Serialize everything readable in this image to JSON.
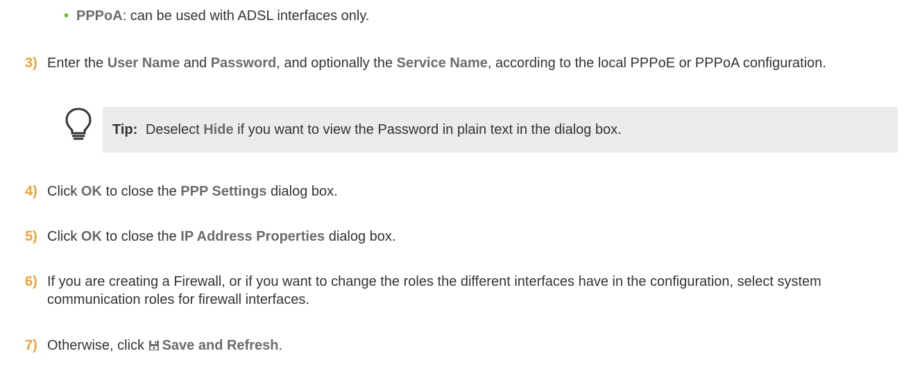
{
  "bullet": {
    "symbol": "•",
    "term": "PPPoA",
    "text": ": can be used with ADSL interfaces only."
  },
  "steps": [
    {
      "num": "3)",
      "parts": {
        "a": "Enter the ",
        "b": "User Name",
        "c": " and ",
        "d": "Password",
        "e": ", and optionally the ",
        "f": "Service Name",
        "g": ", according to the local PPPoE or PPPoA configuration."
      }
    },
    {
      "num": "4)",
      "parts": {
        "a": "Click ",
        "b": "OK",
        "c": " to close the ",
        "d": "PPP Settings",
        "e": " dialog box."
      }
    },
    {
      "num": "5)",
      "parts": {
        "a": "Click ",
        "b": "OK",
        "c": " to close the ",
        "d": "IP Address Properties",
        "e": " dialog box."
      }
    },
    {
      "num": "6)",
      "text": "If you are creating a Firewall, or if you want to change the roles the different interfaces have in the configuration, select system communication roles for firewall interfaces."
    },
    {
      "num": "7)",
      "parts": {
        "a": "Otherwise, click ",
        "b": "Save and Refresh",
        "c": "."
      }
    }
  ],
  "tip": {
    "label": "Tip:",
    "pre": "Deselect ",
    "term": "Hide",
    "post": " if you want to view the Password in plain text in the dialog box."
  },
  "icons": {
    "tip": "lightbulb-icon",
    "save": "save-icon"
  },
  "colors": {
    "step_number": "#f0a030",
    "bullet": "#6abf2a",
    "highlight": "#6b6b6b",
    "tip_background": "#ebebeb"
  }
}
